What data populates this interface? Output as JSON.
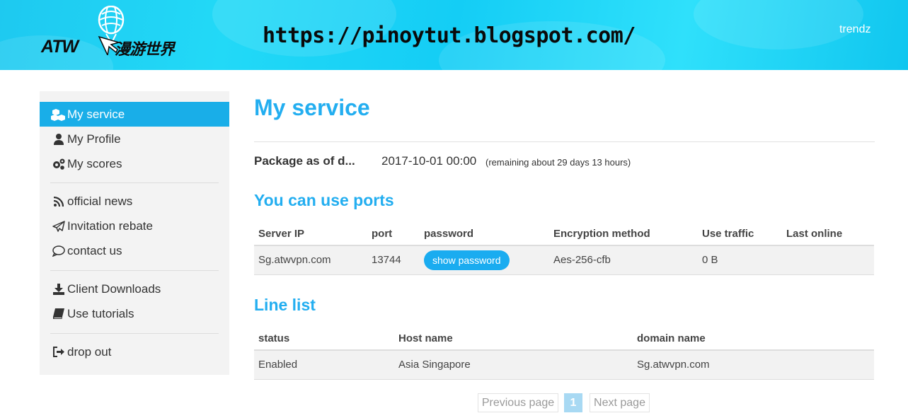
{
  "header": {
    "logo_brand": "ATW",
    "logo_cn": "漫游世界",
    "watermark_url": "https://pinoytut.blogspot.com/",
    "username": "trendz"
  },
  "sidebar": {
    "items": [
      {
        "label": "My service",
        "icon": "cubes-icon",
        "active": true
      },
      {
        "label": "My Profile",
        "icon": "user-icon"
      },
      {
        "label": "My scores",
        "icon": "cogs-icon"
      },
      {
        "label": "official news",
        "icon": "rss-icon"
      },
      {
        "label": "Invitation rebate",
        "icon": "paper-plane-icon"
      },
      {
        "label": "contact us",
        "icon": "comment-icon"
      },
      {
        "label": "Client Downloads",
        "icon": "download-icon"
      },
      {
        "label": "Use tutorials",
        "icon": "book-icon"
      },
      {
        "label": "drop out",
        "icon": "sign-out-icon"
      }
    ]
  },
  "main": {
    "title": "My service",
    "package": {
      "label": "Package as of d...",
      "date": "2017-10-01 00:00",
      "remaining": "(remaining about 29 days 13 hours)"
    },
    "ports": {
      "title": "You can use ports",
      "headers": [
        "Server IP",
        "port",
        "password",
        "Encryption method",
        "Use traffic",
        "Last online"
      ],
      "row": {
        "server_ip": "Sg.atwvpn.com",
        "port": "13744",
        "password_button": "show password",
        "encryption": "Aes-256-cfb",
        "traffic": "0 B",
        "last_online": ""
      }
    },
    "lines": {
      "title": "Line list",
      "headers": [
        "status",
        "Host name",
        "domain name"
      ],
      "row": {
        "status": "Enabled",
        "host": "Asia Singapore",
        "domain": "Sg.atwvpn.com"
      }
    },
    "pager": {
      "previous": "Previous page",
      "current": "1",
      "next": "Next page"
    }
  },
  "colors": {
    "accent": "#23aef0",
    "sidebar_active": "#19aee8",
    "header_cyan": "#1ec9f0"
  }
}
